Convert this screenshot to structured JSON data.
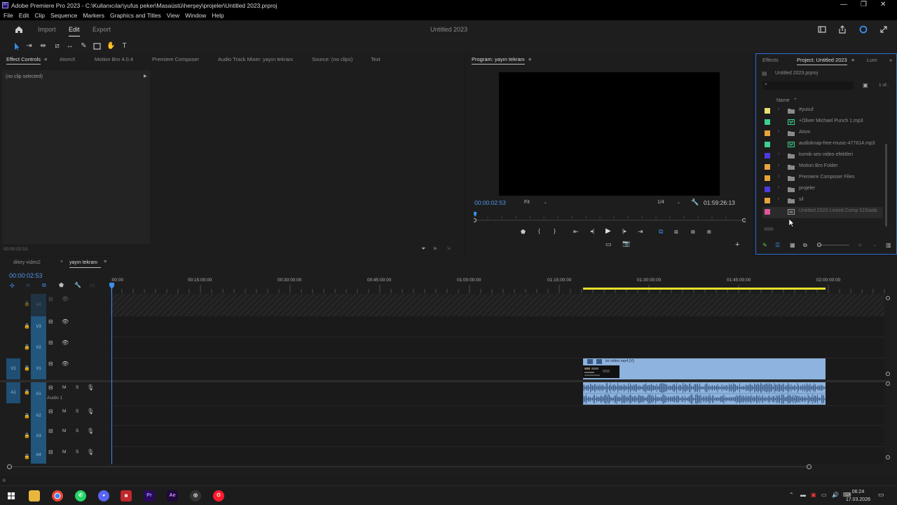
{
  "window": {
    "title": "Adobe Premiere Pro 2023 - C:\\Kullanıcılar\\yufus peker\\Masaüstü\\herşey\\projeler\\Untitled 2023.prproj",
    "minimize": "—",
    "restore": "❐",
    "close": "✕"
  },
  "menu": [
    "File",
    "Edit",
    "Clip",
    "Sequence",
    "Markers",
    "Graphics and Titles",
    "View",
    "Window",
    "Help"
  ],
  "header": {
    "import_label": "Import",
    "edit_label": "Edit",
    "export_label": "Export",
    "document_title": "Untitled 2023"
  },
  "effects_panel": {
    "tabs": [
      "Effect Controls",
      "AtomX",
      "Motion Bro 4.0.4",
      "Premiere Composer",
      "Audio Track Mixer: yayın tekranı",
      "Source: (no clips)",
      "Text"
    ],
    "no_clip_text": "(no clip selected)",
    "timecode": "00:00:02:53"
  },
  "program_monitor": {
    "title": "Program: yayın tekranı",
    "current_timecode": "00:00:02:53",
    "fit_label": "Fit",
    "resolution": "1/4",
    "duration_timecode": "01:59:26:13"
  },
  "project_panel": {
    "tabs": [
      "Effects",
      "Project: Untitled 2023",
      "Lum"
    ],
    "project_file": "Untitled 2023.prproj",
    "item_count": "1 of..",
    "search_placeholder": "",
    "column_name": "Name",
    "items": [
      {
        "name": "#yusuf",
        "type": "folder",
        "color": "#e6e071"
      },
      {
        "name": "+Oliver Michael  Punch 1.mp3",
        "type": "audio",
        "color": "#3ecf8e"
      },
      {
        "name": "Atom",
        "type": "folder",
        "color": "#e8a33c"
      },
      {
        "name": "audioknap-free-music-477614.mp3",
        "type": "audio",
        "color": "#3ecf8e"
      },
      {
        "name": "komik-ses-video efektleri",
        "type": "folder",
        "color": "#4b3ce0"
      },
      {
        "name": "Motion Bro Folder",
        "type": "folder",
        "color": "#e8a33c"
      },
      {
        "name": "Premiere Composer Files",
        "type": "folder",
        "color": "#e8a33c"
      },
      {
        "name": "projeler",
        "type": "folder",
        "color": "#4b3ce0"
      },
      {
        "name": "sil",
        "type": "folder",
        "color": "#e8a33c"
      },
      {
        "name": "Untitled 2023 Linked Comp 515/ada",
        "type": "comp",
        "color": "#e0559a"
      }
    ]
  },
  "timeline": {
    "tabs": [
      "dikey video2",
      "yayın tekranı"
    ],
    "timecode": "00:00:02:53",
    "ruler": [
      ":00:00",
      "00:15:00:00",
      "00:30:00:00",
      "00:45:00:00",
      "01:00:00:00",
      "01:15:00:00",
      "01:30:00:00",
      "01:45:00:00",
      "02:00:00:00"
    ],
    "video_tracks": [
      "V4",
      "V3",
      "V2",
      "V1"
    ],
    "audio_tracks": [
      "A1",
      "A2",
      "A3",
      "A4"
    ],
    "audio1_label": "Audio 1",
    "source_v1": "V1",
    "source_a1": "A1",
    "clip_name": "loi video.mp4 [V]",
    "mute_label": "M",
    "solo_label": "S"
  },
  "taskbar": {
    "time": "06:24",
    "date": "17.03.2026"
  }
}
